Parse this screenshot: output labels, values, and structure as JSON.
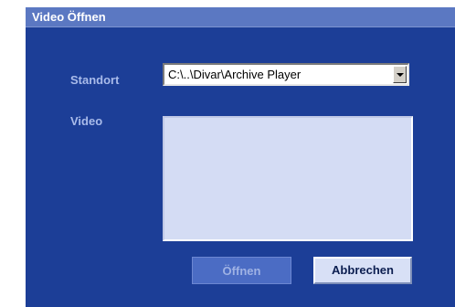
{
  "window": {
    "title": "Video Öffnen"
  },
  "form": {
    "location_label": "Standort",
    "location_value": "C:\\..\\Divar\\Archive Player",
    "video_label": "Video",
    "video_items": []
  },
  "buttons": {
    "open_label": "Öffnen",
    "open_enabled": false,
    "cancel_label": "Abbrechen"
  },
  "colors": {
    "dialog_background": "#1c3e97",
    "titlebar": "#5b78c2",
    "label_text": "#a9bbea",
    "listbox_background": "#d4dcf4"
  }
}
